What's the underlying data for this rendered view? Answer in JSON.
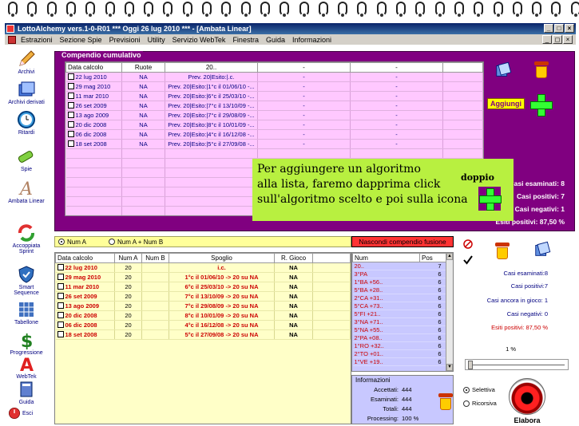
{
  "window": {
    "title": "LottoAlchemy vers.1-0-R01  ***  Oggi 26 lug 2010  ***  - [Ambata Linear]"
  },
  "menu": [
    "Estrazioni",
    "Sezione Spie",
    "Previsioni",
    "Utility",
    "Servizio WebTek",
    "Finestra",
    "Guida",
    "Informazioni"
  ],
  "sidebar": [
    {
      "label": "Archivi",
      "icon": "pencil-icon"
    },
    {
      "label": "Archivi derivati",
      "icon": "document-stack-icon"
    },
    {
      "label": "Ritardi",
      "icon": "clock-icon"
    },
    {
      "label": "Spie",
      "icon": "telescope-icon"
    },
    {
      "label": "Ambata Linear",
      "icon": "letter-a-icon"
    },
    {
      "label": "Accoppiata Sprint",
      "icon": "recycle-arrows-icon"
    },
    {
      "label": "Smart Sequence",
      "icon": "shield-icon"
    },
    {
      "label": "Tabellone",
      "icon": "table-icon"
    },
    {
      "label": "Progressione",
      "icon": "dollar-icon"
    },
    {
      "label": "WebTek",
      "icon": "webtek-a-icon"
    },
    {
      "label": "Guida",
      "icon": "book-icon"
    },
    {
      "label": "Esci",
      "icon": "power-icon"
    }
  ],
  "cumulativo": {
    "legend": "Compendio cumulativo",
    "headers": [
      "Data calcolo",
      "Ruote",
      "20..",
      "-",
      "-"
    ],
    "rows": [
      [
        "22 lug 2010",
        "NA",
        "Prev. 20|Esito:|.c.",
        "-",
        "-"
      ],
      [
        "29 mag 2010",
        "NA",
        "Prev. 20|Esito:|1°c il 01/06/10 -...",
        "-",
        "-"
      ],
      [
        "11 mar 2010",
        "NA",
        "Prev. 20|Esito:|6°c il 25/03/10 -...",
        "-",
        "-"
      ],
      [
        "26 set 2009",
        "NA",
        "Prev. 20|Esito:|7°c il 13/10/09 -...",
        "-",
        "-"
      ],
      [
        "13 ago 2009",
        "NA",
        "Prev. 20|Esito:|7°c il 29/08/09 -...",
        "-",
        "-"
      ],
      [
        "20 dic 2008",
        "NA",
        "Prev. 20|Esito:|8°c il 10/01/09 -...",
        "-",
        "-"
      ],
      [
        "06 dic 2008",
        "NA",
        "Prev. 20|Esito:|4°c il 16/12/08 -...",
        "-",
        "-"
      ],
      [
        "18 set 2008",
        "NA",
        "Prev. 20|Esito:|5°c il 27/09/08 -...",
        "-",
        "-"
      ]
    ],
    "aggiungi_label": "Aggiungi",
    "stats": {
      "esaminati": "Casi esaminati: 8",
      "positivi": "Casi positivi: 7",
      "negativi": "Casi negativi: 1",
      "esiti": "Esiti positivi: 87,50 %"
    }
  },
  "annotation": {
    "line1": "Per aggiungere un algoritmo",
    "line2": "alla lista, faremo dapprima click",
    "line3": "sull'algoritmo scelto e poi sulla icona",
    "word": "doppio"
  },
  "radio": {
    "opt1": "Num A",
    "opt2": "Num A + Num B"
  },
  "spoglio": {
    "headers": [
      "Data calcolo",
      "Num A",
      "Num B",
      "Spoglio",
      "R. Gioco"
    ],
    "rows": [
      [
        "22 lug 2010",
        "20",
        "",
        "i.c.",
        "NA"
      ],
      [
        "29 mag 2010",
        "20",
        "",
        "1°c il 01/06/10 -> 20 su NA",
        "NA"
      ],
      [
        "11 mar 2010",
        "20",
        "",
        "6°c il 25/03/10 -> 20 su NA",
        "NA"
      ],
      [
        "26 set 2009",
        "20",
        "",
        "7°c il 13/10/09 -> 20 su NA",
        "NA"
      ],
      [
        "13 ago 2009",
        "20",
        "",
        "7°c il 29/08/09 -> 20 su NA",
        "NA"
      ],
      [
        "20 dic 2008",
        "20",
        "",
        "8°c il 10/01/09 -> 20 su NA",
        "NA"
      ],
      [
        "06 dic 2008",
        "20",
        "",
        "4°c il 16/12/08 -> 20 su NA",
        "NA"
      ],
      [
        "18 set 2008",
        "20",
        "",
        "5°c il 27/09/08 -> 20 su NA",
        "NA"
      ]
    ]
  },
  "fusione": {
    "button": "Nascondi compendio fusione",
    "headers": [
      "Num",
      "Pos"
    ],
    "rows": [
      [
        "20..",
        "7"
      ],
      [
        "3°PA",
        "6"
      ],
      [
        "1°BA +56..",
        "6"
      ],
      [
        "5°BA +28..",
        "6"
      ],
      [
        "2°CA +31..",
        "6"
      ],
      [
        "5°CA +73..",
        "6"
      ],
      [
        "5°FI +21..",
        "6"
      ],
      [
        "3°NA +71..",
        "6"
      ],
      [
        "5°NA +55..",
        "6"
      ],
      [
        "2°PA +08..",
        "6"
      ],
      [
        "1°RO +32..",
        "6"
      ],
      [
        "2°TO +01..",
        "6"
      ],
      [
        "1°VE +19..",
        "6"
      ]
    ]
  },
  "info": {
    "title": "Informazioni",
    "accettati_k": "Accettati:",
    "accettati_v": "444",
    "esaminati_k": "Esaminati:",
    "esaminati_v": "444",
    "totali_k": "Totali:",
    "totali_v": "444",
    "processing_k": "Processing:",
    "processing_v": "100 %"
  },
  "rightpanel": {
    "esaminati": "Casi esaminati:8",
    "positivi": "Casi positivi:7",
    "ancora": "Casi ancora in gioco: 1",
    "negativi": "Casi negativi: 0",
    "esiti": "Esiti positivi: 87,50 %",
    "percent": "1 %",
    "selettiva": "Selettiva",
    "ricorsiva": "Ricorsiva",
    "elabora": "Elabora"
  }
}
